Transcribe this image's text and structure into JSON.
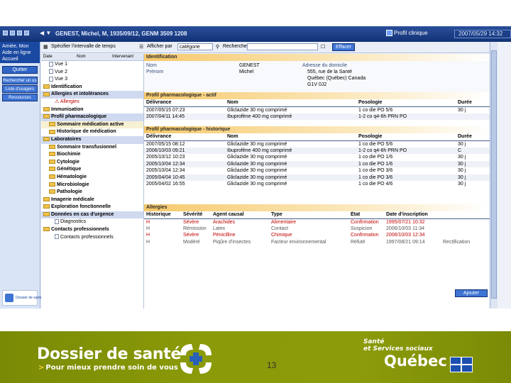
{
  "window": {
    "patient_line": "GENEST, Michel, M, 1935/09/12, GENM 3509 1208",
    "profile_button": "Profil clinique",
    "datetime": "2007/05/29 14:32"
  },
  "leftnav": {
    "user_name": "Amiée, Mon",
    "help": "Aide en ligne",
    "home": "Accueil",
    "quit": "Quitter",
    "buttons": [
      "Rechercher un usager",
      "Liste d'usagers",
      "Ressources"
    ],
    "logo_text": "Dossier de santé"
  },
  "toolbar": {
    "period": "Spécifier l'intervalle de temps",
    "display_by": "Afficher par",
    "display_value": "catégorie",
    "search": "Rechercher",
    "button": "Effacer"
  },
  "tree": {
    "columns": [
      "Date",
      "Nom",
      "Intervenant"
    ],
    "nodes": [
      {
        "label": "Vue 1",
        "indent": 1,
        "icon": "doc"
      },
      {
        "label": "Vue 2",
        "indent": 1,
        "icon": "doc"
      },
      {
        "label": "Vue 3",
        "indent": 1,
        "icon": "doc"
      },
      {
        "label": "Identification",
        "indent": 0,
        "icon": "folder",
        "bold": true
      },
      {
        "label": "Allergies et intolérances",
        "indent": 0,
        "icon": "folder",
        "bold": true,
        "sel": true
      },
      {
        "label": "Allergies",
        "indent": 2,
        "icon": "alert"
      },
      {
        "label": "Immunisation",
        "indent": 0,
        "icon": "folder",
        "bold": true
      },
      {
        "label": "Profil pharmacologique",
        "indent": 0,
        "icon": "folder",
        "bold": true,
        "sel": true
      },
      {
        "label": "Sommaire médication active",
        "indent": 1,
        "icon": "folder",
        "bold": true,
        "hl": true
      },
      {
        "label": "Historique de médication",
        "indent": 1,
        "icon": "folder",
        "bold": true
      },
      {
        "label": "Laboratoires",
        "indent": 0,
        "icon": "folder",
        "bold": true,
        "sel": true
      },
      {
        "label": "Sommaire transfusionnel",
        "indent": 1,
        "icon": "folder",
        "bold": true
      },
      {
        "label": "Biochimie",
        "indent": 1,
        "icon": "folder",
        "bold": true
      },
      {
        "label": "Cytologie",
        "indent": 1,
        "icon": "folder",
        "bold": true
      },
      {
        "label": "Génétique",
        "indent": 1,
        "icon": "folder",
        "bold": true
      },
      {
        "label": "Hématologie",
        "indent": 1,
        "icon": "folder",
        "bold": true
      },
      {
        "label": "Microbiologie",
        "indent": 1,
        "icon": "folder",
        "bold": true
      },
      {
        "label": "Pathologie",
        "indent": 1,
        "icon": "folder",
        "bold": true
      },
      {
        "label": "Imagerie médicale",
        "indent": 0,
        "icon": "folder",
        "bold": true
      },
      {
        "label": "Exploration fonctionnelle",
        "indent": 0,
        "icon": "folder",
        "bold": true
      },
      {
        "label": "Données en cas d'urgence",
        "indent": 0,
        "icon": "folder",
        "bold": true,
        "sel": true
      },
      {
        "label": "Diagnostics",
        "indent": 2,
        "icon": "doc"
      },
      {
        "label": "Contacts professionnels",
        "indent": 0,
        "icon": "folder",
        "bold": true
      },
      {
        "label": "Contacts professionnels",
        "indent": 2,
        "icon": "doc"
      }
    ]
  },
  "identification": {
    "title": "Identification",
    "name_label": "Nom",
    "name_value": "GENEST",
    "firstname_label": "Prénom",
    "firstname_value": "Michel",
    "address_label": "Adresse du domicile",
    "address_lines": [
      "555, rue de la Santé",
      "Québec (Québec) Canada",
      "G1V 0J2"
    ]
  },
  "active_profile": {
    "title": "Profil pharmacologique - actif",
    "columns": [
      "Délivrance",
      "Nom",
      "Posologie",
      "Durée"
    ],
    "rows": [
      [
        "2007/05/15 07:23",
        "Gliclazide 30 mg comprimé",
        "1 co die PO 5/6",
        "30 j"
      ],
      [
        "2007/04/11 14:45",
        "Ibuprofène 400 mg comprimé",
        "1-2 co q4-6h PRN PO",
        ""
      ]
    ]
  },
  "history_profile": {
    "title": "Profil pharmacologique - historique",
    "columns": [
      "Délivrance",
      "Nom",
      "Posologie",
      "Durée"
    ],
    "rows": [
      [
        "2007/05/15 08:12",
        "Gliclazide 30 mg comprimé",
        "1 co die PO 5/6",
        "30 j"
      ],
      [
        "2006/10/03 09:21",
        "Ibuprofène 400 mg comprimé",
        "1-2 co q4-6h PRN PO",
        "C"
      ],
      [
        "2005/10/12 10:23",
        "Gliclazide 30 mg comprimé",
        "1 co die PO 1/6",
        "30 j"
      ],
      [
        "2005/10/04 12:34",
        "Gliclazide 30 mg comprimé",
        "1 co die PO 1/6",
        "30 j"
      ],
      [
        "2005/10/04 12:34",
        "Gliclazide 30 mg comprimé",
        "1 co die PO 3/6",
        "30 j"
      ],
      [
        "2005/04/04 10:45",
        "Gliclazide 30 mg comprimé",
        "1 co die PO 3/6",
        "30 j"
      ],
      [
        "2005/04/02 16:55",
        "Gliclazide 30 mg comprimé",
        "1 co die PO 4/6",
        "30 j"
      ]
    ]
  },
  "allergies": {
    "title": "Allergies",
    "columns": [
      "Historique",
      "Sévérité",
      "Agent causal",
      "Type",
      "État",
      "Date d'inscription",
      ""
    ],
    "rows": [
      [
        "H",
        "Sévère",
        "Arachides",
        "Alimentaire",
        "Confirmation",
        "1995/07/21 10:32",
        ""
      ],
      [
        "H",
        "Rémission",
        "Latex",
        "Contact",
        "Suspicion",
        "2006/10/03 11:34",
        ""
      ],
      [
        "H",
        "Sévère",
        "Pénicilline",
        "Chimique",
        "Confirmation",
        "2006/10/03 12:34",
        ""
      ],
      [
        "H",
        "Modéré",
        "Piqûre d'insectes",
        "Facteur environnemental",
        "Réfuté",
        "1997/08/21 09:14",
        "Rectification"
      ]
    ],
    "row_styles": [
      "red",
      "gray",
      "red",
      "gray"
    ]
  },
  "close_button": "Ajouter",
  "footer": {
    "brand": "Dossier de santé",
    "tagline": "Pour mieux prendre soin de vous",
    "gov_line1": "Santé",
    "gov_line2": "et Services sociaux",
    "gov_name": "Québec",
    "page_number": "13"
  }
}
